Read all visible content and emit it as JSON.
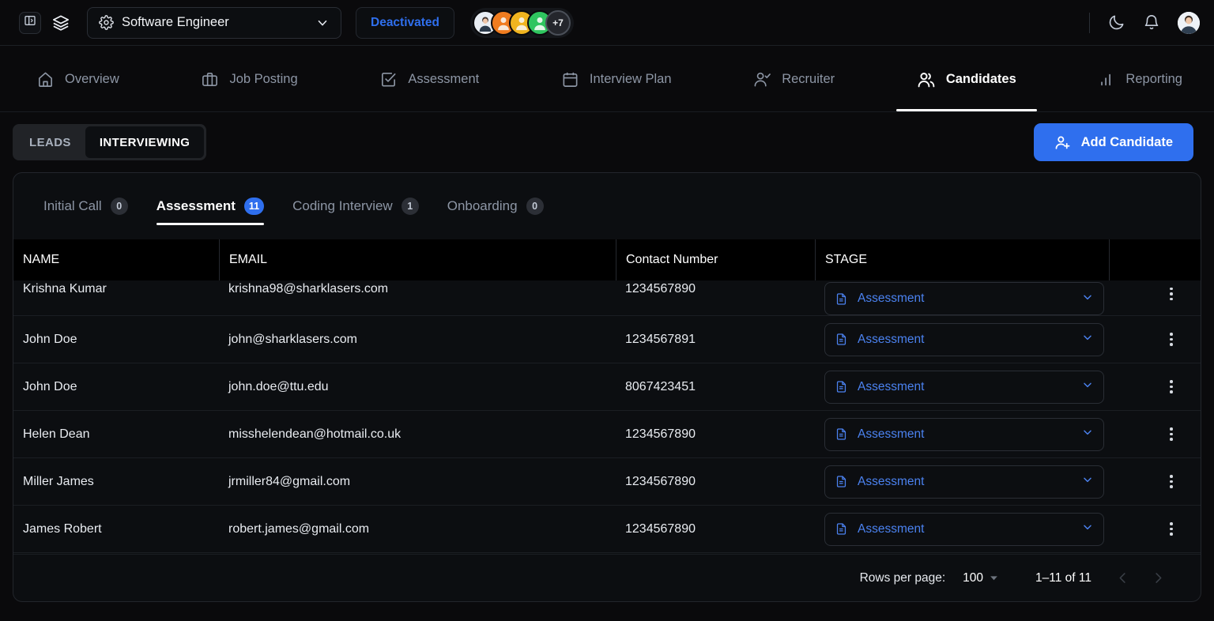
{
  "header": {
    "sidebar_toggle_icon": "sidebar-toggle-icon",
    "layers_icon": "layers-icon",
    "role": {
      "label": "Software Engineer",
      "gear_icon": "gear-icon",
      "chevron_icon": "chevron-down-icon"
    },
    "status_button": "Deactivated",
    "avatars": {
      "more_count": "+7",
      "colors": [
        "#e9eef4",
        "#f07c1f",
        "#f0b41f",
        "#2fc55f"
      ]
    },
    "theme_icon": "moon-icon",
    "notification_icon": "bell-icon",
    "profile_icon": "user-avatar"
  },
  "nav": {
    "items": [
      {
        "label": "Overview",
        "icon": "home-icon",
        "active": false
      },
      {
        "label": "Job Posting",
        "icon": "briefcase-icon",
        "active": false
      },
      {
        "label": "Assessment",
        "icon": "check-square-icon",
        "active": false
      },
      {
        "label": "Interview Plan",
        "icon": "calendar-icon",
        "active": false
      },
      {
        "label": "Recruiter",
        "icon": "user-check-icon",
        "active": false
      },
      {
        "label": "Candidates",
        "icon": "users-icon",
        "active": true
      },
      {
        "label": "Reporting",
        "icon": "bar-chart-icon",
        "active": false
      }
    ]
  },
  "toolbar": {
    "segments": [
      {
        "label": "LEADS",
        "active": false
      },
      {
        "label": "INTERVIEWING",
        "active": true
      }
    ],
    "add_button": {
      "label": "Add Candidate",
      "icon": "user-plus-icon",
      "color": "#2f6fee"
    }
  },
  "stage_tabs": [
    {
      "label": "Initial Call",
      "count": "0",
      "active": false
    },
    {
      "label": "Assessment",
      "count": "11",
      "active": true
    },
    {
      "label": "Coding Interview",
      "count": "1",
      "active": false
    },
    {
      "label": "Onboarding",
      "count": "0",
      "active": false
    }
  ],
  "table": {
    "columns": [
      "NAME",
      "EMAIL",
      "Contact Number",
      "STAGE",
      ""
    ],
    "rows": [
      {
        "name": "Krishna Kumar",
        "email": "krishna98@sharklasers.com",
        "phone": "1234567890",
        "stage": "Assessment",
        "stage_icon": "document-icon",
        "chevron_icon": "chevron-down-icon",
        "menu_icon": "more-vertical-icon"
      },
      {
        "name": "John Doe",
        "email": "john@sharklasers.com",
        "phone": "1234567891",
        "stage": "Assessment",
        "stage_icon": "document-icon",
        "chevron_icon": "chevron-down-icon",
        "menu_icon": "more-vertical-icon"
      },
      {
        "name": "John Doe",
        "email": "john.doe@ttu.edu",
        "phone": "8067423451",
        "stage": "Assessment",
        "stage_icon": "document-icon",
        "chevron_icon": "chevron-down-icon",
        "menu_icon": "more-vertical-icon"
      },
      {
        "name": "Helen Dean",
        "email": "misshelendean@hotmail.co.uk",
        "phone": "1234567890",
        "stage": "Assessment",
        "stage_icon": "document-icon",
        "chevron_icon": "chevron-down-icon",
        "menu_icon": "more-vertical-icon"
      },
      {
        "name": "Miller James",
        "email": "jrmiller84@gmail.com",
        "phone": "1234567890",
        "stage": "Assessment",
        "stage_icon": "document-icon",
        "chevron_icon": "chevron-down-icon",
        "menu_icon": "more-vertical-icon"
      },
      {
        "name": "James Robert",
        "email": "robert.james@gmail.com",
        "phone": "1234567890",
        "stage": "Assessment",
        "stage_icon": "document-icon",
        "chevron_icon": "chevron-down-icon",
        "menu_icon": "more-vertical-icon"
      }
    ]
  },
  "pagination": {
    "rows_per_page_label": "Rows per page:",
    "rows_per_page_value": "100",
    "range": "1–11 of 11",
    "prev_icon": "chevron-left-icon",
    "next_icon": "chevron-right-icon"
  },
  "accent": "#2f6fee"
}
